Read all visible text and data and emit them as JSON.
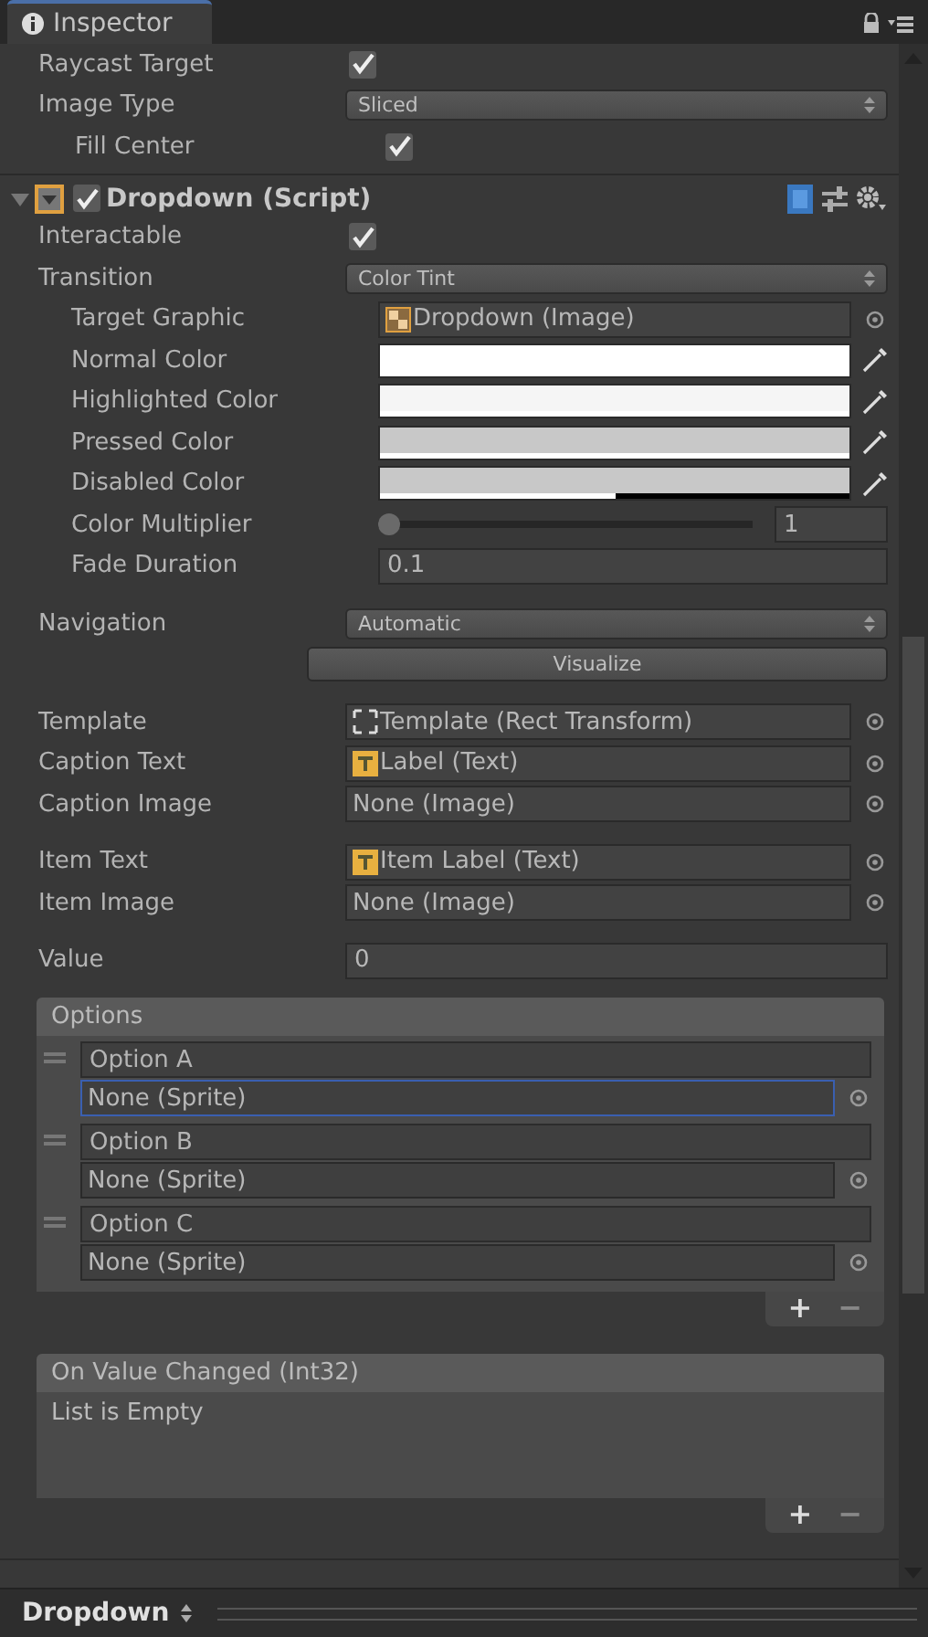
{
  "tab": {
    "label": "Inspector",
    "selected": true
  },
  "top_fields": [
    {
      "label": "Raycast Target",
      "kind": "checkbox",
      "checked": true
    },
    {
      "label": "Image Type",
      "kind": "dropdown",
      "value": "Sliced",
      "children": [
        {
          "label": "Fill Center",
          "kind": "checkbox",
          "checked": true
        }
      ]
    }
  ],
  "component": {
    "title": "Dropdown (Script)",
    "enabled": true,
    "expanded": true
  },
  "sections": [
    [
      {
        "label": "Interactable",
        "kind": "checkbox",
        "checked": true
      },
      {
        "label": "Transition",
        "kind": "dropdown",
        "value": "Color Tint",
        "children": [
          {
            "label": "Target Graphic",
            "kind": "image",
            "value": "Dropdown (Image)"
          },
          {
            "label": "Normal Color",
            "kind": "color",
            "color": "#ffffff",
            "level": 1
          },
          {
            "label": "Highlighted Color",
            "kind": "color",
            "color": "#f5f5f5",
            "level": 1
          },
          {
            "label": "Pressed Color",
            "kind": "color",
            "color": "#c8c8c8",
            "level": 1
          },
          {
            "label": "Disabled Color",
            "kind": "color",
            "color": "#c8c8c8",
            "level": 0.5
          },
          {
            "label": "Color Multiplier",
            "kind": "slider",
            "level": 0,
            "value": "1"
          },
          {
            "label": "Fade Duration",
            "kind": "number",
            "value": "0.1"
          }
        ]
      }
    ],
    [
      {
        "label": "Navigation",
        "kind": "dropdown",
        "value": "Automatic"
      },
      {
        "kind": "button",
        "value": "Visualize"
      }
    ],
    [
      {
        "label": "Template",
        "kind": "transform",
        "value": "Template (Rect Transform)"
      },
      {
        "label": "Caption Text",
        "kind": "text",
        "value": "Label (Text)"
      },
      {
        "label": "Caption Image",
        "kind": "object",
        "value": "None (Image)"
      }
    ],
    [
      {
        "label": "Item Text",
        "kind": "text",
        "value": "Item Label (Text)"
      },
      {
        "label": "Item Image",
        "kind": "object",
        "value": "None (Image)"
      }
    ],
    [
      {
        "label": "Value",
        "kind": "number",
        "value": "0"
      }
    ]
  ],
  "options": {
    "header": "Options",
    "items": [
      {
        "text": "Option A",
        "sprite": "None (Sprite)",
        "focused": true
      },
      {
        "text": "Option B",
        "sprite": "None (Sprite)",
        "focused": false
      },
      {
        "text": "Option C",
        "sprite": "None (Sprite)",
        "focused": false
      }
    ],
    "add": "+",
    "remove": "−"
  },
  "event": {
    "header": "On Value Changed (Int32)",
    "body": "List is Empty",
    "add": "+",
    "remove": "−"
  },
  "bottom_bar": {
    "label": "Dropdown"
  }
}
